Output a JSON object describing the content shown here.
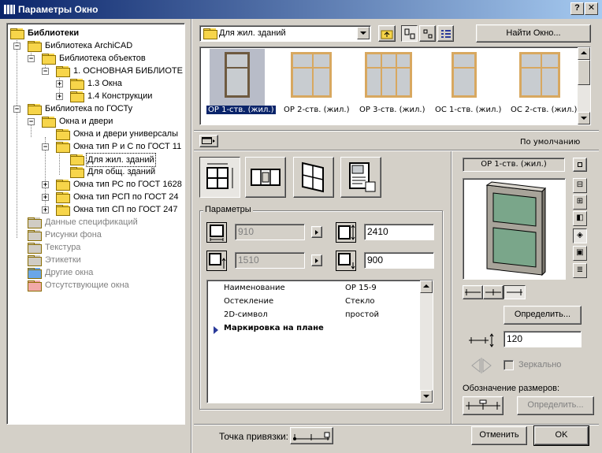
{
  "window": {
    "title": "Параметры Окно",
    "help_label": "?",
    "close_label": "✕"
  },
  "tree": {
    "items": [
      {
        "label": "Библиотеки",
        "bold": true
      },
      {
        "label": "Библиотека ArchiCAD"
      },
      {
        "label": "Библиотека объектов"
      },
      {
        "label": "1. ОСНОВНАЯ БИБЛИОТЕ"
      },
      {
        "label": "1.3 Окна"
      },
      {
        "label": "1.4 Конструкции"
      },
      {
        "label": "Библиотека по ГОСТу"
      },
      {
        "label": "Окна и двери"
      },
      {
        "label": "Окна и двери универсалы"
      },
      {
        "label": "Окна тип Р и С по ГОСТ 11"
      },
      {
        "label": "Для жил. зданий"
      },
      {
        "label": "Для общ. зданий"
      },
      {
        "label": "Окна тип РС по ГОСТ 1628"
      },
      {
        "label": "Окна тип РСП по ГОСТ 24"
      },
      {
        "label": "Окна тип СП по ГОСТ 247"
      },
      {
        "label": "Данные спецификаций"
      },
      {
        "label": "Рисунки фона"
      },
      {
        "label": "Текстура"
      },
      {
        "label": "Этикетки"
      },
      {
        "label": "Другие окна"
      },
      {
        "label": "Отсутствующие окна"
      }
    ]
  },
  "toolbar": {
    "folder_combo_value": "Для жил. зданий",
    "find_button_label": "Найти Окно..."
  },
  "gallery": {
    "items": [
      {
        "label": "ОР 1-ств. (жил.)",
        "selected": true
      },
      {
        "label": "ОР 2-ств. (жил.)"
      },
      {
        "label": "ОР 3-ств. (жил.)"
      },
      {
        "label": "ОС 1-ств. (жил.)"
      },
      {
        "label": "ОС 2-ств. (жил.)"
      }
    ]
  },
  "defaults_label": "По умолчанию",
  "params": {
    "group_label": "Параметры",
    "width_value": "910",
    "height_value": "2410",
    "sill_value": "1510",
    "reveal_value": "900",
    "list": [
      {
        "name": "Наименование",
        "value": "ОР 15-9"
      },
      {
        "name": "Остекление",
        "value": "Стекло"
      },
      {
        "name": "2D-символ",
        "value": "простой"
      },
      {
        "name": "Маркировка на плане",
        "value": "",
        "bold": true
      }
    ]
  },
  "preview": {
    "name_label": "ОР 1-ств. (жил.)",
    "define_button_label": "Определить...",
    "offset_value": "120",
    "mirror_label": "Зеркально",
    "dimension_label": "Обозначение размеров:",
    "define_dim_button_label": "Определить..."
  },
  "footer": {
    "anchor_label": "Точка привязки:",
    "cancel_label": "Отменить",
    "ok_label": "OK"
  },
  "colors": {
    "title_start": "#0a246a",
    "title_end": "#a6caf0",
    "dialog_bg": "#d4d0c8",
    "selection": "#0a246a",
    "folder": "#f7d54a",
    "frame_wood": "#d8a860"
  }
}
